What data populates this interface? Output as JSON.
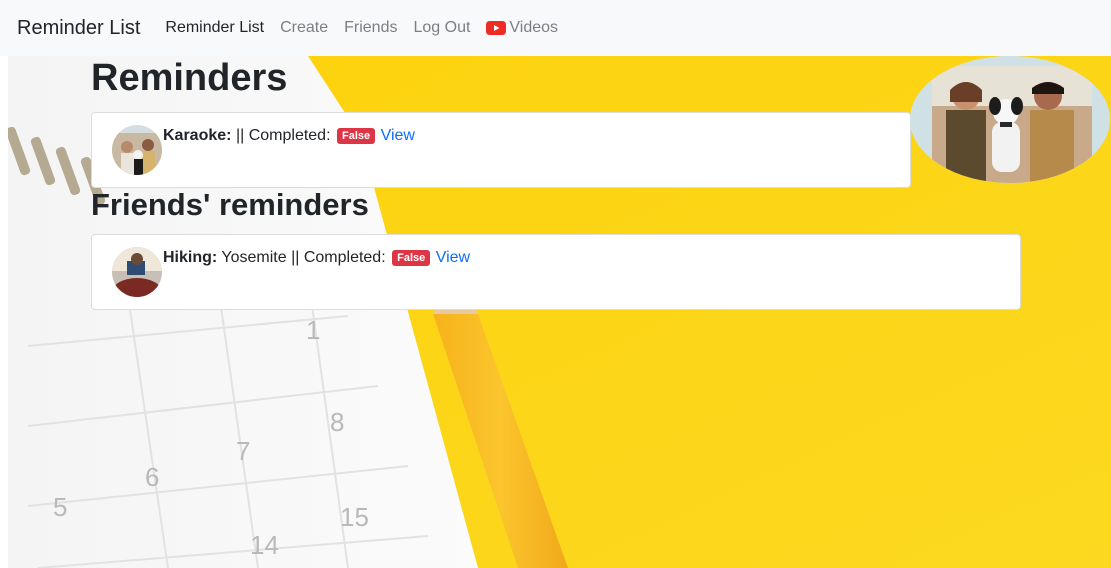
{
  "navbar": {
    "brand": "Reminder List",
    "links": [
      {
        "label": "Reminder List",
        "active": true
      },
      {
        "label": "Create",
        "active": false
      },
      {
        "label": "Friends",
        "active": false
      },
      {
        "label": "Log Out",
        "active": false
      },
      {
        "label": "Videos",
        "active": false,
        "icon": "youtube-icon"
      }
    ]
  },
  "reminders": {
    "heading": "Reminders",
    "items": [
      {
        "title": "Karaoke:",
        "description": "",
        "separator": "||",
        "completed_label": "Completed:",
        "status": "False",
        "link": "View"
      }
    ]
  },
  "friends": {
    "heading": "Friends' reminders",
    "items": [
      {
        "title": "Hiking:",
        "description": "Yosemite",
        "separator": "||",
        "completed_label": "Completed:",
        "status": "False",
        "link": "View"
      }
    ]
  },
  "colors": {
    "background_yellow": "#fcd512",
    "badge_red": "#dc3545",
    "link_blue": "#0d6efd",
    "navbar_bg": "#f8f9fa"
  }
}
